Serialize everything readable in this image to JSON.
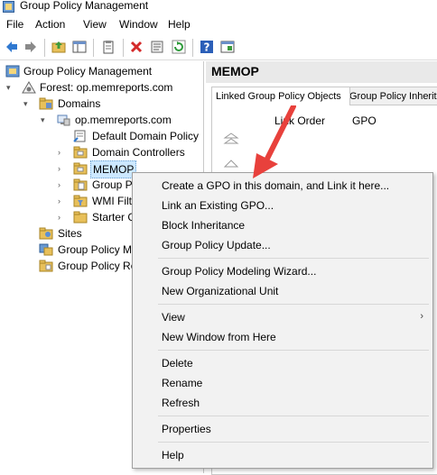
{
  "window": {
    "title": "Group Policy Management"
  },
  "menu": {
    "items": [
      "File",
      "Action",
      "View",
      "Window",
      "Help"
    ]
  },
  "tree": {
    "root": "Group Policy Management",
    "forest": "Forest: op.memreports.com",
    "domains": "Domains",
    "domain": "op.memreports.com",
    "default_policy": "Default Domain Policy",
    "domain_controllers": "Domain Controllers",
    "memop": "MEMOP",
    "group_policy_objects": "Group P",
    "wmi_filters": "WMI Filt",
    "starter_gpos": "Starter G",
    "sites": "Sites",
    "modeling": "Group Policy M",
    "results": "Group Policy Re"
  },
  "right_pane": {
    "title": "MEMOP",
    "tabs": [
      "Linked Group Policy Objects",
      "Group Policy Inherita"
    ],
    "columns": [
      "Link Order",
      "GPO"
    ]
  },
  "context_menu": {
    "items": [
      "Create a GPO in this domain, and Link it here...",
      "Link an Existing GPO...",
      "Block Inheritance",
      "Group Policy Update...",
      "Group Policy Modeling Wizard...",
      "New Organizational Unit",
      "View",
      "New Window from Here",
      "Delete",
      "Rename",
      "Refresh",
      "Properties",
      "Help"
    ]
  },
  "colors": {
    "annotation_arrow": "#e8413c",
    "selection": "#cce8ff",
    "folder": "#e8c05a"
  },
  "icons": [
    "back-icon",
    "forward-icon",
    "up-folder-icon",
    "show-hide-tree-icon",
    "clipboard-icon",
    "delete-icon",
    "properties-icon",
    "refresh-icon",
    "help-icon",
    "export-icon"
  ]
}
